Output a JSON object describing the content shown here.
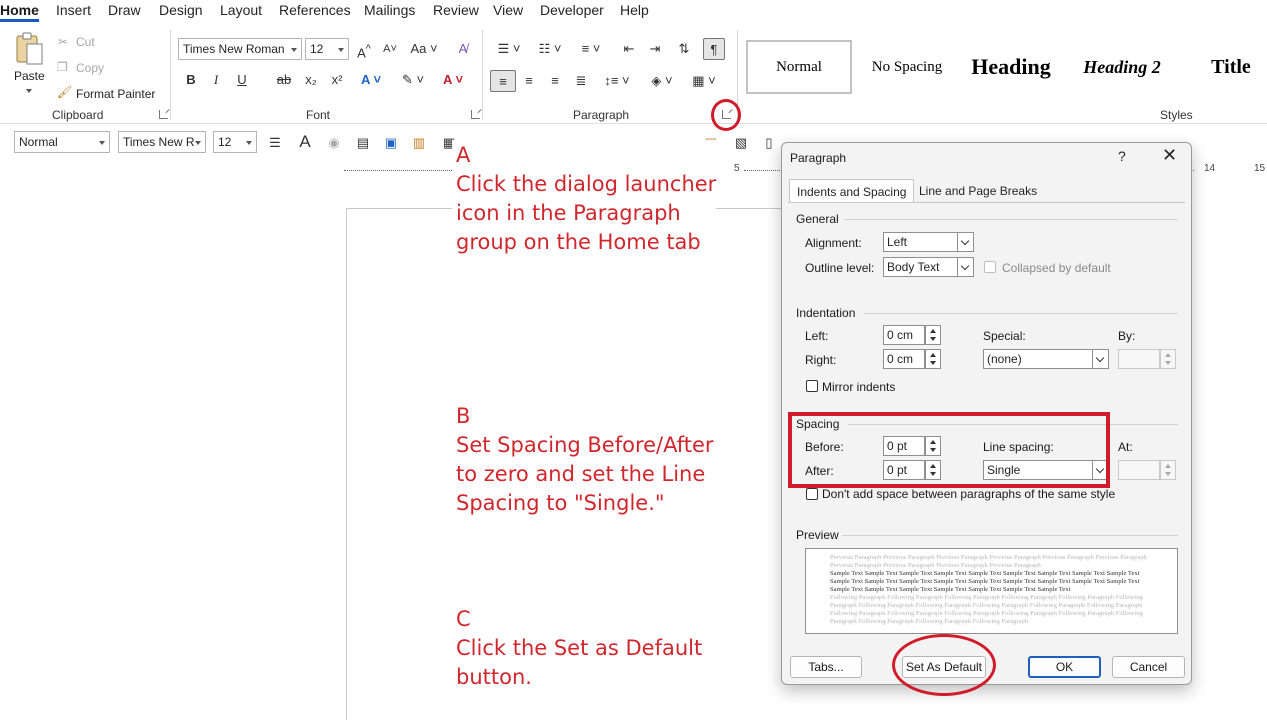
{
  "tabs": [
    "Home",
    "Insert",
    "Draw",
    "Design",
    "Layout",
    "References",
    "Mailings",
    "Review",
    "View",
    "Developer",
    "Help"
  ],
  "clipboard": {
    "paste": "Paste",
    "cut": "Cut",
    "copy": "Copy",
    "format_painter": "Format Painter",
    "label": "Clipboard"
  },
  "font": {
    "name": "Times New Roman",
    "size": "12",
    "label": "Font"
  },
  "paragraph": {
    "label": "Paragraph"
  },
  "styles": {
    "items": [
      "Normal",
      "No Spacing",
      "Heading",
      "Heading 2",
      "Title"
    ],
    "label": "Styles"
  },
  "toolbar2": {
    "style": "Normal",
    "font": "Times New R",
    "size": "12"
  },
  "ruler": {
    "marks": [
      "5",
      "14",
      "15"
    ]
  },
  "annotations": {
    "a": [
      "A",
      "Click the dialog launcher",
      "icon in the Paragraph",
      "group on the Home tab"
    ],
    "b": [
      "B",
      "Set Spacing Before/After",
      "to zero and set the Line",
      "Spacing to \"Single.\""
    ],
    "c": [
      "C",
      "Click the Set as Default",
      "button."
    ]
  },
  "dialog": {
    "title": "Paragraph",
    "help": "?",
    "close": "✕",
    "tabs": [
      "Indents and Spacing",
      "Line and Page Breaks"
    ],
    "general": {
      "heading": "General",
      "alignment_label": "Alignment:",
      "alignment_value": "Left",
      "outline_label": "Outline level:",
      "outline_value": "Body Text",
      "collapsed_label": "Collapsed by default"
    },
    "indentation": {
      "heading": "Indentation",
      "left_label": "Left:",
      "left_value": "0 cm",
      "right_label": "Right:",
      "right_value": "0 cm",
      "special_label": "Special:",
      "special_value": "(none)",
      "by_label": "By:",
      "mirror_label": "Mirror indents"
    },
    "spacing": {
      "heading": "Spacing",
      "before_label": "Before:",
      "before_value": "0 pt",
      "after_label": "After:",
      "after_value": "0 pt",
      "line_label": "Line spacing:",
      "line_value": "Single",
      "at_label": "At:",
      "dont_add_label": "Don't add space between paragraphs of the same style"
    },
    "preview": {
      "heading": "Preview",
      "previous": "Previous Paragraph Previous Paragraph Previous Paragraph Previous Paragraph Previous Paragraph Previous Paragraph Previous Paragraph Previous Paragraph Previous Paragraph Previous Paragraph",
      "sample": "Sample Text Sample Text Sample Text Sample Text Sample Text Sample Text Sample Text Sample Text Sample Text Sample Text Sample Text Sample Text Sample Text Sample Text Sample Text Sample Text Sample Text Sample Text Sample Text Sample Text Sample Text Sample Text Sample Text Sample Text Sample Text",
      "following": "Following Paragraph Following Paragraph Following Paragraph Following Paragraph Following Paragraph Following Paragraph Following Paragraph Following Paragraph Following Paragraph Following Paragraph Following Paragraph Following Paragraph Following Paragraph Following Paragraph Following Paragraph Following Paragraph Following Paragraph Following Paragraph Following Paragraph Following Paragraph"
    },
    "buttons": {
      "tabs": "Tabs...",
      "set_default": "Set As Default",
      "ok": "OK",
      "cancel": "Cancel"
    }
  }
}
